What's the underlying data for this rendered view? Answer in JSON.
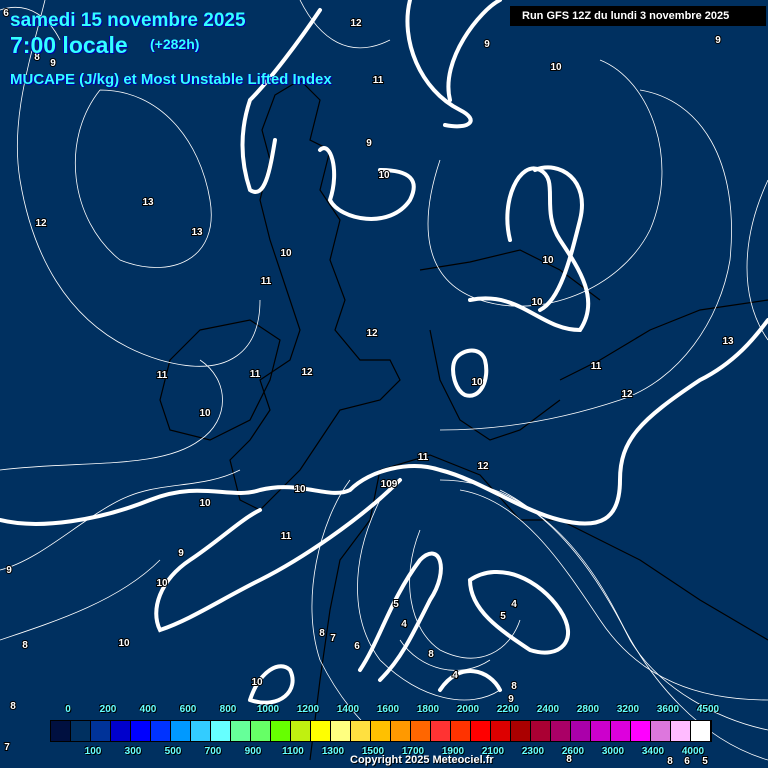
{
  "header": {
    "date": "samedi 15 novembre 2025",
    "time": "7:00 locale",
    "offset": "(+282h)",
    "parameter": "MUCAPE (J/kg) et Most Unstable Lifted Index",
    "run": "Run GFS 12Z du lundi 3 novembre 2025"
  },
  "colorbar": {
    "colors": [
      "#001040",
      "#003060",
      "#003399",
      "#0000cc",
      "#0000ff",
      "#0033ff",
      "#0099ff",
      "#33ccff",
      "#66ffff",
      "#66ff99",
      "#66ff66",
      "#66ff00",
      "#c0f010",
      "#ffff00",
      "#ffff80",
      "#ffe040",
      "#ffc000",
      "#ff9900",
      "#ff6600",
      "#ff3333",
      "#ff3300",
      "#ff0000",
      "#dd0000",
      "#aa0000",
      "#aa0033",
      "#aa0066",
      "#aa00aa",
      "#cc00cc",
      "#dd00dd",
      "#ff00ff",
      "#dd77dd",
      "#ffbbff",
      "#ffffff"
    ],
    "top_labels": [
      "0",
      "200",
      "400",
      "600",
      "800",
      "1000",
      "1200",
      "1400",
      "1600",
      "1800",
      "2000",
      "2200",
      "2400",
      "2800",
      "3200",
      "3600",
      "4500"
    ],
    "bottom_labels": [
      "100",
      "300",
      "500",
      "700",
      "900",
      "1100",
      "1300",
      "1500",
      "1700",
      "1900",
      "2100",
      "2300",
      "2600",
      "3000",
      "3400",
      "4000"
    ]
  },
  "contour_labels": [
    "6",
    "8",
    "9",
    "12",
    "9",
    "10",
    "9",
    "11",
    "13",
    "12",
    "13",
    "9",
    "10",
    "10",
    "10",
    "10",
    "11",
    "12",
    "13",
    "11",
    "11",
    "12",
    "11",
    "10",
    "12",
    "10",
    "11",
    "12",
    "10",
    "109",
    "10",
    "11",
    "9",
    "10",
    "9",
    "10",
    "8",
    "5",
    "4",
    "5",
    "8",
    "7",
    "6",
    "4",
    "8",
    "4",
    "8",
    "9",
    "10",
    "8",
    "7",
    "8",
    "8",
    "6",
    "5"
  ],
  "footer": {
    "copyright": "Copyright 2025 Meteociel.fr"
  },
  "colors": {
    "background": "#003060",
    "title": "#33ffff",
    "land": "#000000",
    "contour": "#ffffff"
  }
}
